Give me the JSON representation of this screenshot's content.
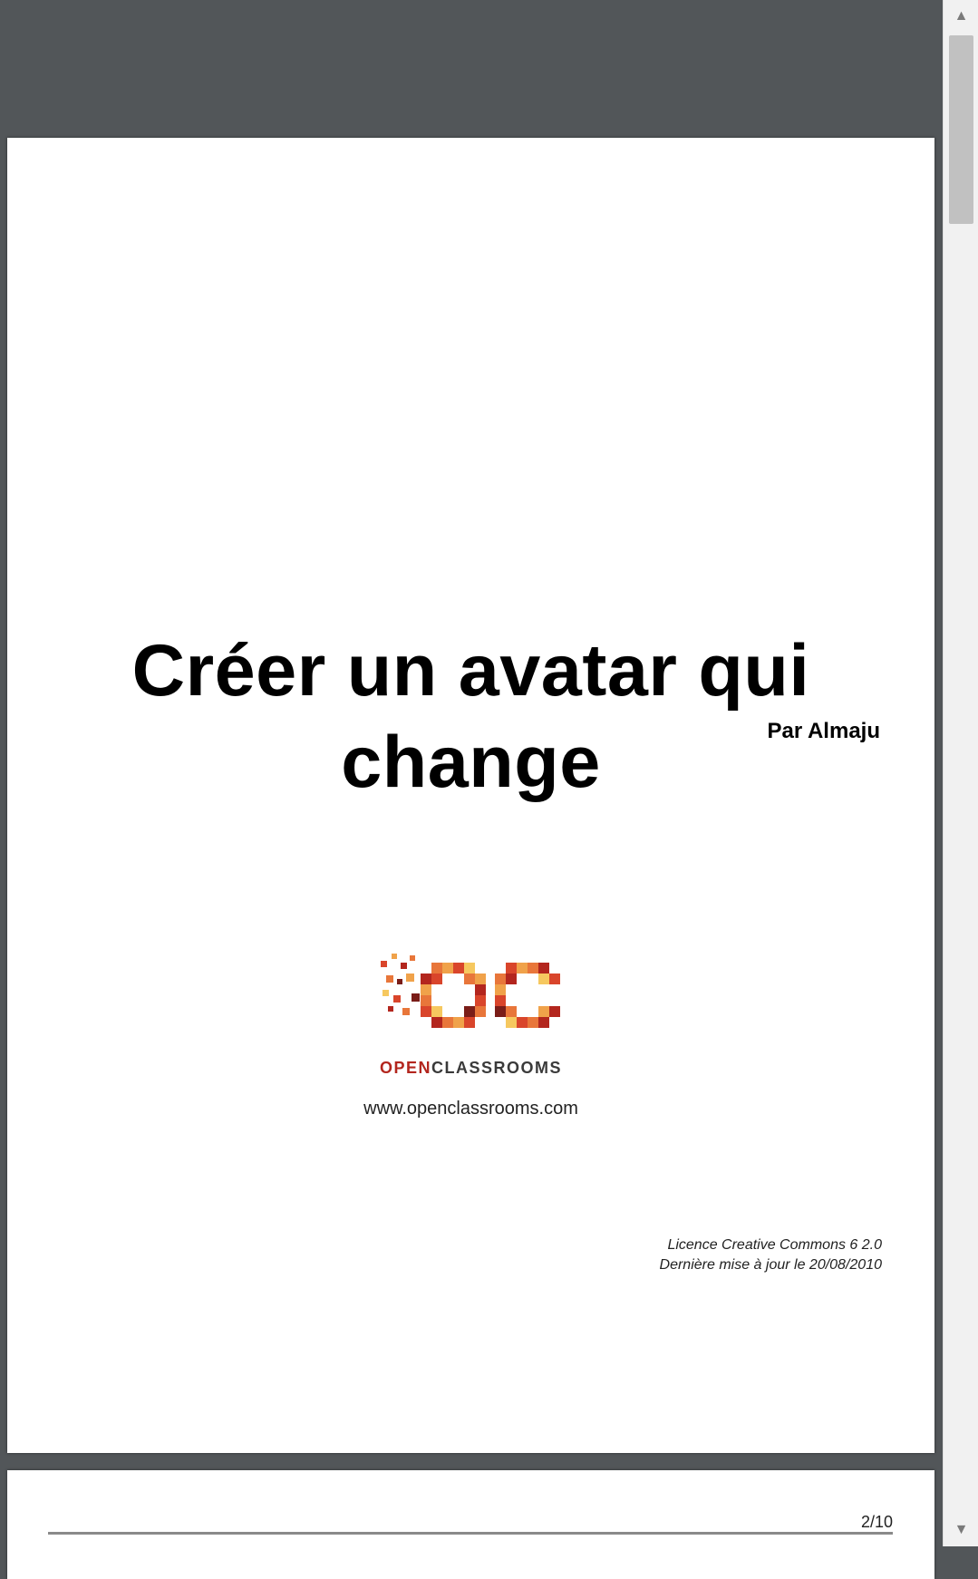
{
  "document": {
    "title": "Créer un avatar qui change",
    "author": "Par Almaju",
    "logo": {
      "word_open": "OPEN",
      "word_classrooms": "CLASSROOMS",
      "colors": [
        "#b3261e",
        "#d9452b",
        "#e8763a",
        "#f0a24a",
        "#f6c85f",
        "#7a1d18"
      ]
    },
    "website": "www.openclassrooms.com",
    "license_line1": "Licence Creative Commons 6 2.0",
    "license_line2": "Dernière mise à jour le 20/08/2010"
  },
  "next_page": {
    "page_number": "2/10"
  },
  "scrollbar": {
    "up_icon": "chevron-up-icon",
    "down_icon": "chevron-down-icon"
  }
}
